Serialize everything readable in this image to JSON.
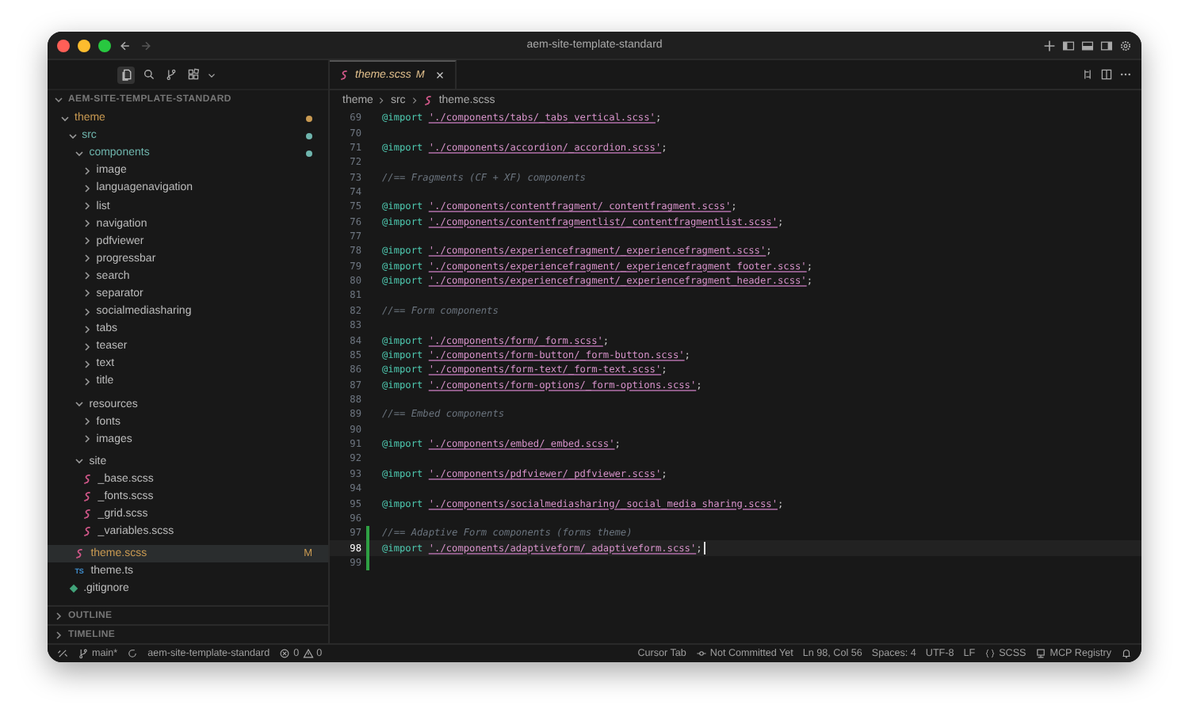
{
  "window": {
    "title": "aem-site-template-standard"
  },
  "activity_bar": [
    {
      "selected": true
    },
    {
      "selected": false
    },
    {
      "selected": false
    },
    {
      "selected": false
    }
  ],
  "explorer": {
    "title": "AEM-SITE-TEMPLATE-STANDARD",
    "expanded": true,
    "tree": [
      {
        "label": "theme",
        "kind": "folder",
        "expanded": true,
        "selected": false,
        "color": "#c99a52",
        "children": [
          {
            "label": "src",
            "kind": "folder",
            "expanded": true,
            "selected": false,
            "color": "#6fb5ad",
            "children": [
              {
                "label": "components",
                "kind": "folder",
                "expanded": true,
                "selected": false,
                "color": "#6fb5ad",
                "children": [
                  {
                    "label": "image",
                    "kind": "folder",
                    "expanded": false,
                    "selected": false
                  },
                  {
                    "label": "languagenavigation",
                    "kind": "folder",
                    "expanded": false,
                    "selected": false
                  },
                  {
                    "label": "list",
                    "kind": "folder",
                    "expanded": false,
                    "selected": false
                  },
                  {
                    "label": "navigation",
                    "kind": "folder",
                    "expanded": false,
                    "selected": false
                  },
                  {
                    "label": "pdfviewer",
                    "kind": "folder",
                    "expanded": false,
                    "selected": false
                  },
                  {
                    "label": "progressbar",
                    "kind": "folder",
                    "expanded": false,
                    "selected": false
                  },
                  {
                    "label": "search",
                    "kind": "folder",
                    "expanded": false,
                    "selected": false
                  },
                  {
                    "label": "separator",
                    "kind": "folder",
                    "expanded": false,
                    "selected": false
                  },
                  {
                    "label": "socialmediasharing",
                    "kind": "folder",
                    "expanded": false,
                    "selected": false
                  },
                  {
                    "label": "tabs",
                    "kind": "folder",
                    "expanded": false,
                    "selected": false
                  },
                  {
                    "label": "teaser",
                    "kind": "folder",
                    "expanded": false,
                    "selected": false
                  },
                  {
                    "label": "text",
                    "kind": "folder",
                    "expanded": false,
                    "selected": false
                  },
                  {
                    "label": "title",
                    "kind": "folder",
                    "expanded": false,
                    "selected": false
                  }
                ]
              },
              {
                "label": "resources",
                "kind": "folder",
                "expanded": true,
                "selected": false,
                "children": [
                  {
                    "label": "fonts",
                    "kind": "folder",
                    "expanded": false,
                    "selected": false
                  },
                  {
                    "label": "images",
                    "kind": "folder",
                    "expanded": false,
                    "selected": false
                  }
                ]
              },
              {
                "label": "site",
                "kind": "folder",
                "expanded": true,
                "selected": false,
                "children": [
                  {
                    "label": "_base.scss",
                    "kind": "scss",
                    "selected": false
                  },
                  {
                    "label": "_fonts.scss",
                    "kind": "scss",
                    "selected": false
                  },
                  {
                    "label": "_grid.scss",
                    "kind": "scss",
                    "selected": false
                  },
                  {
                    "label": "_variables.scss",
                    "kind": "scss",
                    "selected": false
                  }
                ]
              },
              {
                "label": "theme.scss",
                "kind": "scss",
                "selected": true,
                "color": "#c99a52",
                "badge": "M"
              },
              {
                "label": "theme.ts",
                "kind": "ts",
                "icon_text": "TS",
                "selected": false
              }
            ]
          },
          {
            "label": ".gitignore",
            "kind": "config",
            "selected": false
          }
        ]
      }
    ]
  },
  "panels": [
    {
      "title": "OUTLINE",
      "expanded": false
    },
    {
      "title": "TIMELINE",
      "expanded": false
    }
  ],
  "tabs": [
    {
      "label": "theme.scss",
      "badge": "M",
      "selected": true
    }
  ],
  "breadcrumb": [
    "theme",
    "src",
    "theme.scss"
  ],
  "code_lines": [
    {
      "number": "69",
      "kind": "import",
      "keyword": "@import",
      "string": "'./components/tabs/_tabs_vertical.scss'",
      "punct": ";",
      "current": false,
      "changed": false
    },
    {
      "number": "70",
      "kind": "blank",
      "current": false,
      "changed": false
    },
    {
      "number": "71",
      "kind": "import",
      "keyword": "@import",
      "string": "'./components/accordion/_accordion.scss'",
      "punct": ";",
      "current": false,
      "changed": false
    },
    {
      "number": "72",
      "kind": "blank",
      "current": false,
      "changed": false
    },
    {
      "number": "73",
      "kind": "comment",
      "text": "//== Fragments (CF + XF) components",
      "current": false,
      "changed": false
    },
    {
      "number": "74",
      "kind": "blank",
      "current": false,
      "changed": false
    },
    {
      "number": "75",
      "kind": "import",
      "keyword": "@import",
      "string": "'./components/contentfragment/_contentfragment.scss'",
      "punct": ";",
      "current": false,
      "changed": false
    },
    {
      "number": "76",
      "kind": "import",
      "keyword": "@import",
      "string": "'./components/contentfragmentlist/_contentfragmentlist.scss'",
      "punct": ";",
      "current": false,
      "changed": false
    },
    {
      "number": "77",
      "kind": "blank",
      "current": false,
      "changed": false
    },
    {
      "number": "78",
      "kind": "import",
      "keyword": "@import",
      "string": "'./components/experiencefragment/_experiencefragment.scss'",
      "punct": ";",
      "current": false,
      "changed": false
    },
    {
      "number": "79",
      "kind": "import",
      "keyword": "@import",
      "string": "'./components/experiencefragment/_experiencefragment_footer.scss'",
      "punct": ";",
      "current": false,
      "changed": false
    },
    {
      "number": "80",
      "kind": "import",
      "keyword": "@import",
      "string": "'./components/experiencefragment/_experiencefragment_header.scss'",
      "punct": ";",
      "current": false,
      "changed": false
    },
    {
      "number": "81",
      "kind": "blank",
      "current": false,
      "changed": false
    },
    {
      "number": "82",
      "kind": "comment",
      "text": "//== Form components",
      "current": false,
      "changed": false
    },
    {
      "number": "83",
      "kind": "blank",
      "current": false,
      "changed": false
    },
    {
      "number": "84",
      "kind": "import",
      "keyword": "@import",
      "string": "'./components/form/_form.scss'",
      "punct": ";",
      "current": false,
      "changed": false
    },
    {
      "number": "85",
      "kind": "import",
      "keyword": "@import",
      "string": "'./components/form-button/_form-button.scss'",
      "punct": ";",
      "current": false,
      "changed": false
    },
    {
      "number": "86",
      "kind": "import",
      "keyword": "@import",
      "string": "'./components/form-text/_form-text.scss'",
      "punct": ";",
      "current": false,
      "changed": false
    },
    {
      "number": "87",
      "kind": "import",
      "keyword": "@import",
      "string": "'./components/form-options/_form-options.scss'",
      "punct": ";",
      "current": false,
      "changed": false
    },
    {
      "number": "88",
      "kind": "blank",
      "current": false,
      "changed": false
    },
    {
      "number": "89",
      "kind": "comment",
      "text": "//== Embed components",
      "current": false,
      "changed": false
    },
    {
      "number": "90",
      "kind": "blank",
      "current": false,
      "changed": false
    },
    {
      "number": "91",
      "kind": "import",
      "keyword": "@import",
      "string": "'./components/embed/_embed.scss'",
      "punct": ";",
      "current": false,
      "changed": false
    },
    {
      "number": "92",
      "kind": "blank",
      "current": false,
      "changed": false
    },
    {
      "number": "93",
      "kind": "import",
      "keyword": "@import",
      "string": "'./components/pdfviewer/_pdfviewer.scss'",
      "punct": ";",
      "current": false,
      "changed": false
    },
    {
      "number": "94",
      "kind": "blank",
      "current": false,
      "changed": false
    },
    {
      "number": "95",
      "kind": "import",
      "keyword": "@import",
      "string": "'./components/socialmediasharing/_social_media_sharing.scss'",
      "punct": ";",
      "current": false,
      "changed": false
    },
    {
      "number": "96",
      "kind": "blank",
      "current": false,
      "changed": false
    },
    {
      "number": "97",
      "kind": "comment",
      "text": "//== Adaptive Form components (forms theme)",
      "current": false,
      "changed": true
    },
    {
      "number": "98",
      "kind": "import",
      "keyword": "@import",
      "string": "'./components/adaptiveform/_adaptiveform.scss'",
      "punct": ";",
      "current": true,
      "changed": true
    },
    {
      "number": "99",
      "kind": "blank",
      "current": false,
      "changed": true
    }
  ],
  "status_bar": {
    "branch": "main*",
    "project": "aem-site-template-standard",
    "errors": "0",
    "warnings": "0",
    "right": [
      "Cursor Tab",
      "Not Committed Yet",
      "Ln 98, Col 56",
      "Spaces: 4",
      "UTF-8",
      "LF",
      "SCSS",
      "MCP Registry"
    ]
  }
}
